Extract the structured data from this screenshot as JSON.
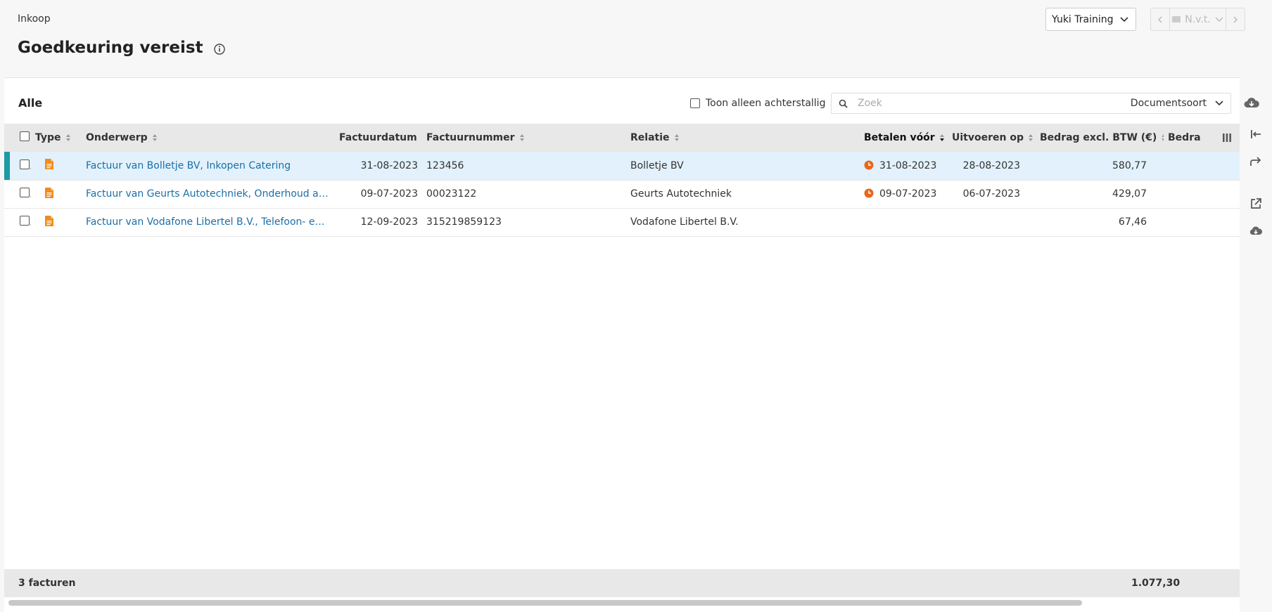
{
  "breadcrumb": "Inkoop",
  "page_title": "Goedkeuring vereist",
  "admin": {
    "selected": "Yuki Training"
  },
  "pager": {
    "label": "N.v.t."
  },
  "list": {
    "title": "Alle",
    "overdue_filter_label": "Toon alleen achterstallig",
    "search_placeholder": "Zoek",
    "doctype_label": "Documentsoort"
  },
  "columns": {
    "type": "Type",
    "subject": "Onderwerp",
    "invoice_date": "Factuurdatum",
    "invoice_number": "Factuurnummer",
    "relation": "Relatie",
    "pay_before": "Betalen vóór",
    "execute_on": "Uitvoeren op",
    "amount_excl": "Bedrag excl. BTW (€)",
    "amount_incl": "Bedra"
  },
  "rows": [
    {
      "subject": "Factuur van Bolletje BV, Inkopen Catering",
      "invoice_date": "31-08-2023",
      "invoice_number": "123456",
      "relation": "Bolletje BV",
      "pay_before": "31-08-2023",
      "execute_on": "28-08-2023",
      "amount": "580,77"
    },
    {
      "subject": "Factuur van Geurts Autotechniek, Onderhoud auto's",
      "invoice_date": "09-07-2023",
      "invoice_number": "00023122",
      "relation": "Geurts Autotechniek",
      "pay_before": "09-07-2023",
      "execute_on": "06-07-2023",
      "amount": "429,07"
    },
    {
      "subject": "Factuur van Vodafone Libertel B.V., Telefoon- en int...",
      "invoice_date": "12-09-2023",
      "invoice_number": "315219859123",
      "relation": "Vodafone Libertel B.V.",
      "pay_before": "",
      "execute_on": "",
      "amount": "67,46"
    }
  ],
  "footer": {
    "count": "3 facturen",
    "total": "1.077,30"
  },
  "colors": {
    "link": "#1a6fa8",
    "doc_icon": "#f08c1e",
    "overdue": "#e8681c",
    "selected_row": "#e2f1fb",
    "selected_marker": "#1c9aa5"
  },
  "icons": [
    "info-icon",
    "chevron-down-icon",
    "search-icon",
    "cloud-download-icon",
    "document-icon",
    "clock-icon",
    "columns-icon",
    "collapse-panel-icon",
    "forward-icon",
    "open-external-icon"
  ]
}
